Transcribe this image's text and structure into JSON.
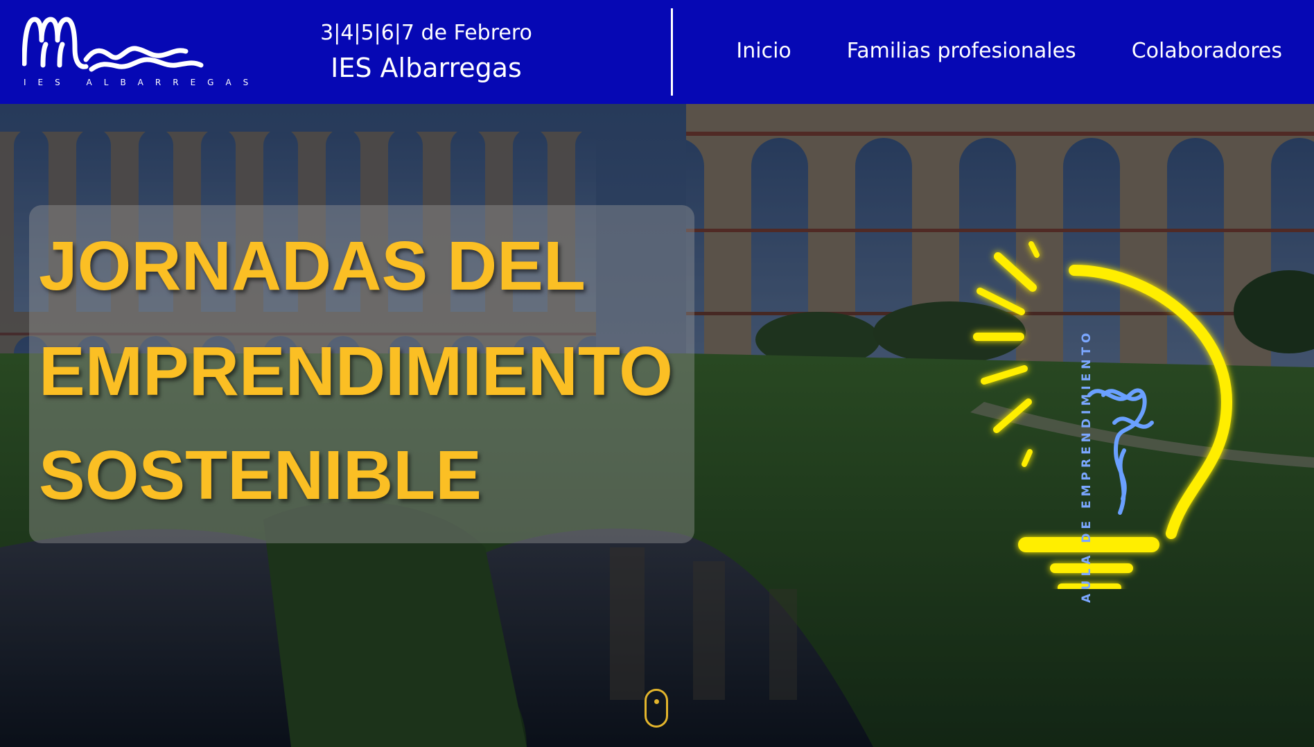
{
  "header": {
    "logo_text": "IES ALBARREGAS",
    "event_dates": "3|4|5|6|7 de Febrero",
    "event_place": "IES Albarregas",
    "nav": [
      {
        "label": "Inicio"
      },
      {
        "label": "Familias profesionales"
      },
      {
        "label": "Colaboradores"
      }
    ]
  },
  "hero": {
    "title_lines": [
      "JORNADAS DEL",
      "EMPRENDIMIENTO",
      "SOSTENIBLE"
    ],
    "bulb_text": "AULA DE EMPRENDIMIENTO",
    "icons": {
      "bulb": "lightbulb-icon",
      "scroll": "scroll-down-icon"
    }
  },
  "colors": {
    "header_bg": "#0608b4",
    "title_text": "#fbbf24",
    "bulb": "#ffee00",
    "bulb_text": "#7ba7ff"
  }
}
